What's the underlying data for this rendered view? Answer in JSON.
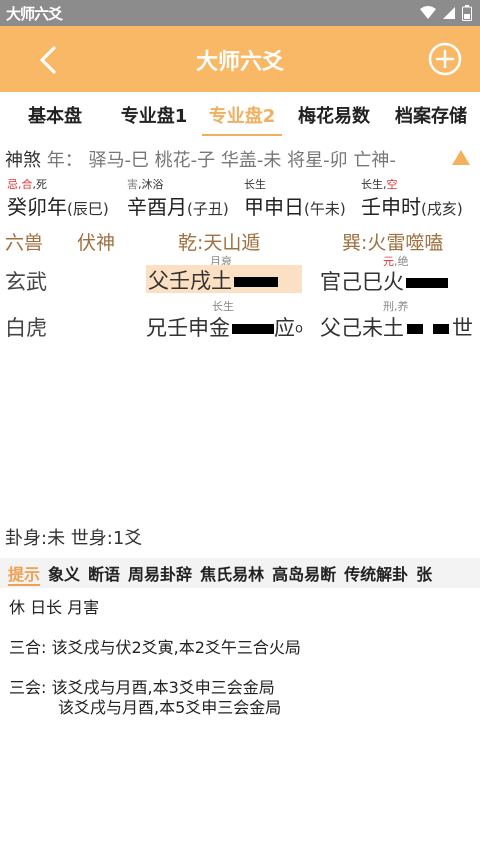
{
  "status_bar": {
    "app_name": "大师六爻"
  },
  "header": {
    "title": "大师六爻"
  },
  "tabs": [
    {
      "label": "基本盘",
      "active": false
    },
    {
      "label": "专业盘1",
      "active": false
    },
    {
      "label": "专业盘2",
      "active": true
    },
    {
      "label": "梅花易数",
      "active": false
    },
    {
      "label": "档案存储",
      "active": false
    }
  ],
  "shensha": {
    "label": "神煞",
    "prefix": "年：",
    "text": "驿马-巳 桃花-子 华盖-未 将星-卯 亡神-"
  },
  "pillars": [
    {
      "ann1": "忌,合",
      "ann2": ",死",
      "main": "癸卯年",
      "sub": "(辰巳)"
    },
    {
      "ann1": "害",
      "ann2": ",沐浴",
      "main": "辛酉月",
      "sub": "(子丑)"
    },
    {
      "ann1": "",
      "ann2": "长生",
      "main": "甲申日",
      "sub": "(午未)"
    },
    {
      "ann1": "长生,",
      "ann2": "空",
      "main": "壬申时",
      "sub": "(戌亥)"
    }
  ],
  "hexagram": {
    "liushou_header": "六兽",
    "fushen_header": "伏神",
    "ben_gua": "乾:天山遁",
    "bian_gua": "巽:火雷噬嗑"
  },
  "yao_rows": [
    {
      "beast": "玄武",
      "ben_label": "月衰",
      "ben": "父壬戌土",
      "bian_label_red": "元",
      "bian_label": ",绝",
      "bian": "官己巳火",
      "shi_ying": ""
    },
    {
      "beast": "白虎",
      "ben_label": "长生",
      "ben": "兄壬申金",
      "bian_label_red": "",
      "bian_label": "刑,养",
      "bian": "父己未土",
      "ben_mark": "应",
      "shi_ying": "世"
    }
  ],
  "guashen": "卦身:未 世身:1爻",
  "subtabs": [
    "提示",
    "象义",
    "断语",
    "周易卦辞",
    "焦氏易林",
    "高岛易断",
    "传统解卦",
    "张"
  ],
  "info": {
    "line1": "休 日长 月害",
    "sanhe": "三合:  该爻戌与伏2爻寅,本2爻午三合火局",
    "sanhui_1": "三会:  该爻戌与月酉,本3爻申三会金局",
    "sanhui_2": "该爻戌与月酉,本5爻申三会金局"
  }
}
